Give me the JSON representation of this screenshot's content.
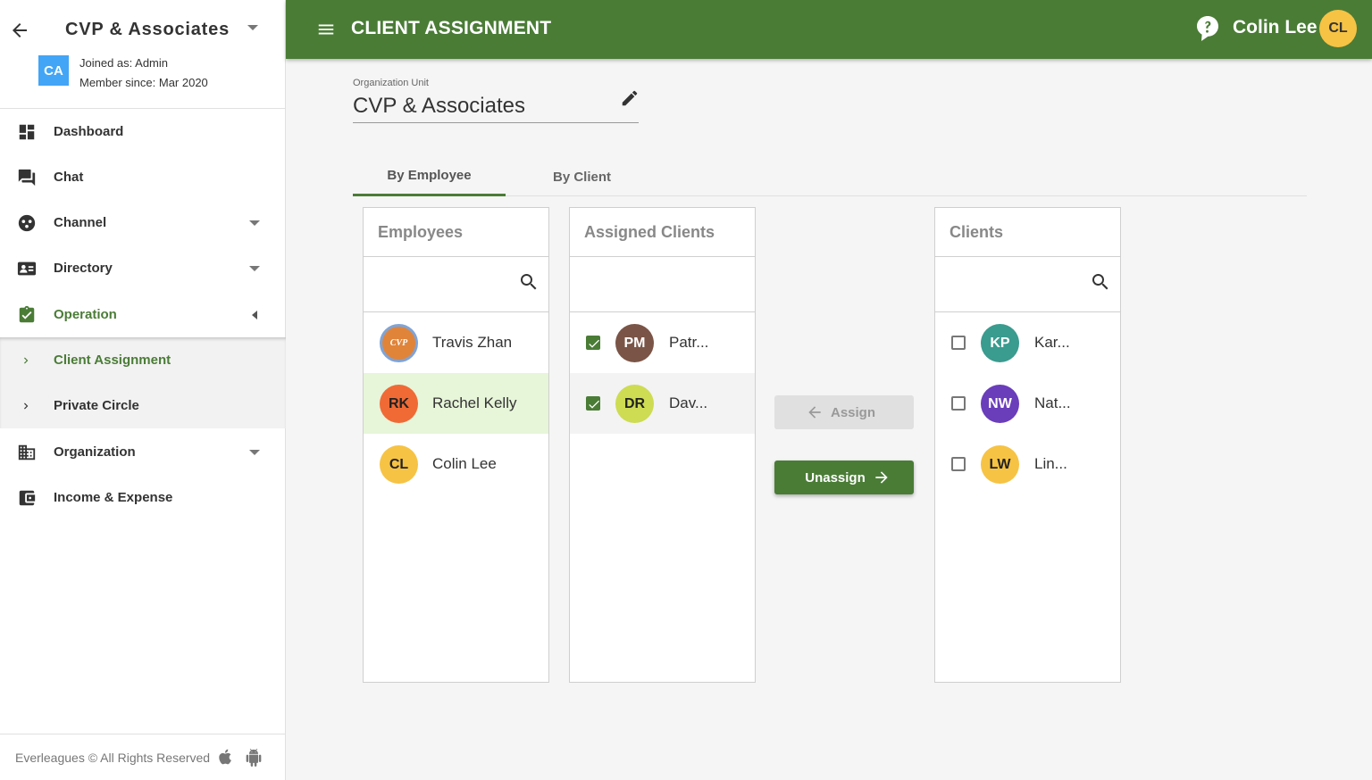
{
  "sidebar": {
    "org_name": "CVP & Associates",
    "avatar_initials": "CA",
    "joined": "Joined as: Admin",
    "member_since": "Member since: Mar 2020",
    "items": [
      {
        "label": "Dashboard",
        "icon": "dashboard-icon"
      },
      {
        "label": "Chat",
        "icon": "chat-icon"
      },
      {
        "label": "Channel",
        "icon": "channel-icon"
      },
      {
        "label": "Directory",
        "icon": "contact-card-icon"
      },
      {
        "label": "Operation",
        "icon": "clipboard-check-icon"
      },
      {
        "label": "Organization",
        "icon": "building-icon"
      },
      {
        "label": "Income & Expense",
        "icon": "wallet-icon"
      }
    ],
    "sub_items": [
      {
        "label": "Client Assignment"
      },
      {
        "label": "Private Circle"
      }
    ],
    "footer": "Everleagues © All Rights Reserved"
  },
  "header": {
    "title": "CLIENT ASSIGNMENT",
    "user_name": "Colin Lee",
    "user_initials": "CL"
  },
  "org_unit": {
    "label": "Organization Unit",
    "value": "CVP & Associates"
  },
  "tabs": [
    {
      "label": "By Employee"
    },
    {
      "label": "By Client"
    }
  ],
  "employees": {
    "title": "Employees",
    "search_placeholder": "",
    "items": [
      {
        "name": "Travis Zhan",
        "initials": "CVP",
        "color": "#e0843a"
      },
      {
        "name": "Rachel Kelly",
        "initials": "RK",
        "color": "#f06a35"
      },
      {
        "name": "Colin Lee",
        "initials": "CL",
        "color": "#f6c344"
      }
    ]
  },
  "assigned_clients": {
    "title": "Assigned Clients",
    "items": [
      {
        "name": "Patr...",
        "initials": "PM",
        "color": "#7a5446",
        "checked": true
      },
      {
        "name": "Dav...",
        "initials": "DR",
        "color": "#cddc52",
        "checked": true
      }
    ]
  },
  "clients": {
    "title": "Clients",
    "search_placeholder": "",
    "items": [
      {
        "name": "Kar...",
        "initials": "KP",
        "color": "#3a9b8f",
        "checked": false
      },
      {
        "name": "Nat...",
        "initials": "NW",
        "color": "#6a3dbb",
        "checked": false
      },
      {
        "name": "Lin...",
        "initials": "LW",
        "color": "#f6c344",
        "checked": false
      }
    ]
  },
  "actions": {
    "assign": "Assign",
    "unassign": "Unassign"
  }
}
